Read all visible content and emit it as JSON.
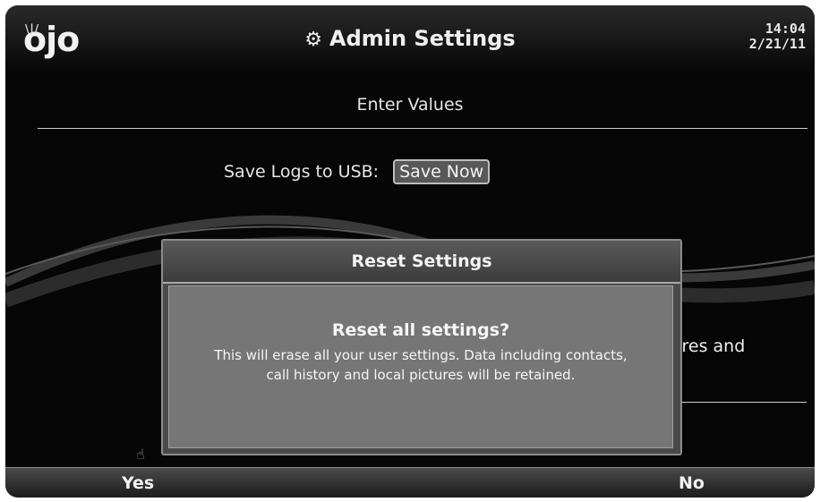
{
  "header": {
    "logo_text": "ojo",
    "title": "Admin Settings",
    "time": "14:04",
    "date": "2/21/11",
    "icons": {
      "title": "gear-icon",
      "cursor": "pointer-hand-icon"
    }
  },
  "content": {
    "section_heading": "Enter Values",
    "logs_label": "Save Logs to USB:",
    "save_now_label": "Save Now",
    "partial_text_behind": "tures and"
  },
  "modal": {
    "title": "Reset Settings",
    "question": "Reset all settings?",
    "message": "This will erase all your user settings. Data including contacts, call history and local pictures will be retained."
  },
  "softkeys": {
    "yes_label": "Yes",
    "no_label": "No"
  },
  "colors": {
    "background": "#060606",
    "modal_body": "#767676",
    "modal_title_bar": "#4a4a4a",
    "text": "#f2f2f2"
  }
}
